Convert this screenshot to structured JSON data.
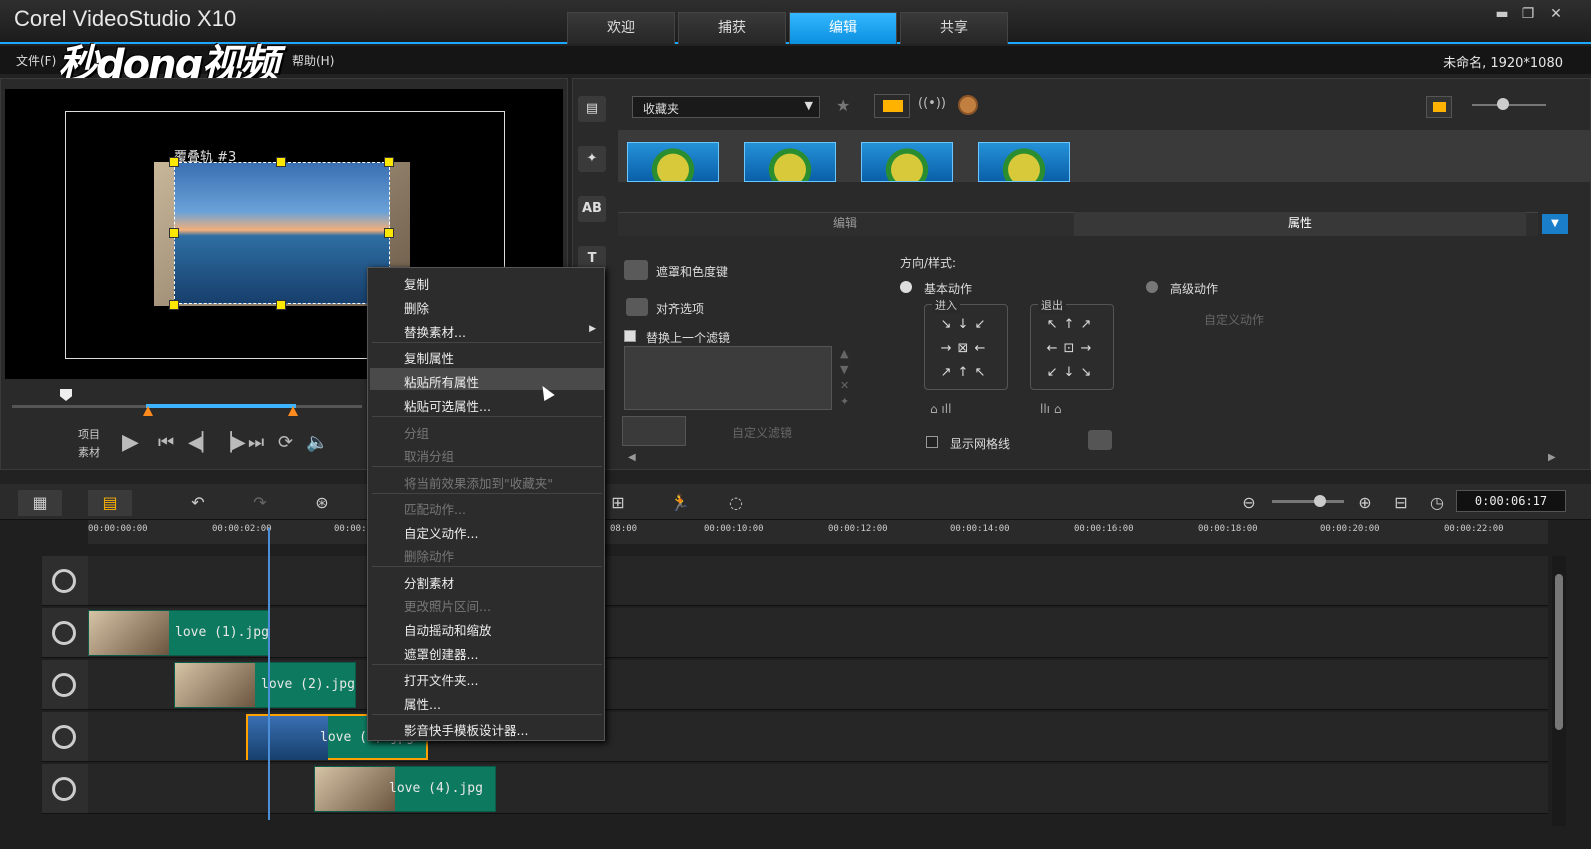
{
  "app": {
    "title": "Corel VideoStudio X10",
    "tabs": [
      "欢迎",
      "捕获",
      "编辑",
      "共享"
    ],
    "active_tab": "编辑",
    "project_info": "未命名, 1920*1080",
    "window_controls": [
      "minimize",
      "restore",
      "close"
    ]
  },
  "menubar": {
    "items": [
      "文件(F)",
      "帮助(H)"
    ],
    "watermark": "秒dong视频"
  },
  "preview": {
    "overlay_label": "覆叠轨 #3",
    "mode_labels": [
      "项目",
      "素材"
    ],
    "controls": [
      "play-icon",
      "start-icon",
      "prev-frame-icon",
      "next-frame-icon",
      "end-icon",
      "repeat-icon",
      "volume-icon"
    ]
  },
  "library": {
    "folder_select": "收藏夹",
    "thumbnails_count": 4,
    "option_tabs": [
      "编辑",
      "属性"
    ],
    "active_option_tab": "属性",
    "options": {
      "mask": "遮罩和色度键",
      "align": "对齐选项",
      "replace_filter": "替换上一个滤镜",
      "custom_filter": "自定义滤镜",
      "direction_style": "方向/样式:",
      "basic_motion": "基本动作",
      "advanced_motion": "高级动作",
      "custom_motion": "自定义动作",
      "enter": "进入",
      "exit": "退出",
      "show_grid": "显示网格线"
    }
  },
  "timeline": {
    "timecode": "0:00:06:17",
    "ruler_ticks": [
      "00:00:00:00",
      "00:00:02:00",
      "00:00:0",
      "08:00",
      "00:00:10:00",
      "00:00:12:00",
      "00:00:14:00",
      "00:00:16:00",
      "00:00:18:00",
      "00:00:20:00",
      "00:00:22:00"
    ],
    "clips": [
      {
        "name": "love (1).jpg"
      },
      {
        "name": "love (2).jpg"
      },
      {
        "name": "love (3).jpg"
      },
      {
        "name": "love (4).jpg"
      }
    ]
  },
  "context_menu": {
    "items": [
      {
        "label": "复制",
        "enabled": true
      },
      {
        "label": "删除",
        "enabled": true
      },
      {
        "label": "替换素材...",
        "enabled": true,
        "submenu": true
      },
      {
        "label": "复制属性",
        "enabled": true
      },
      {
        "label": "粘贴所有属性",
        "enabled": true,
        "highlighted": true
      },
      {
        "label": "粘贴可选属性...",
        "enabled": true
      },
      {
        "label": "分组",
        "enabled": false
      },
      {
        "label": "取消分组",
        "enabled": false
      },
      {
        "label": "将当前效果添加到\"收藏夹\"",
        "enabled": false
      },
      {
        "label": "匹配动作...",
        "enabled": false
      },
      {
        "label": "自定义动作...",
        "enabled": true
      },
      {
        "label": "删除动作",
        "enabled": false
      },
      {
        "label": "分割素材",
        "enabled": true
      },
      {
        "label": "更改照片区间...",
        "enabled": false
      },
      {
        "label": "自动摇动和缩放",
        "enabled": true
      },
      {
        "label": "遮罩创建器...",
        "enabled": true
      },
      {
        "label": "打开文件夹...",
        "enabled": true
      },
      {
        "label": "属性...",
        "enabled": true
      },
      {
        "label": "影音快手模板设计器...",
        "enabled": true
      }
    ]
  },
  "colors": {
    "accent": "#1ea7ff",
    "clip": "#0d7a60",
    "selected_clip_border": "#ffa200"
  }
}
